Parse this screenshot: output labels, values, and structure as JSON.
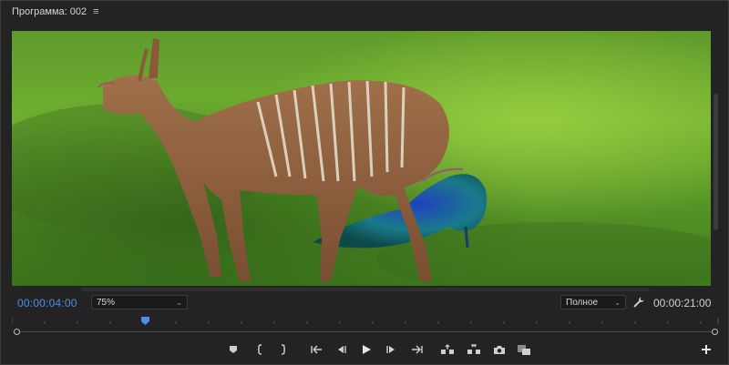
{
  "panel": {
    "title": "Программа: 002",
    "menu_icon": "hamburger-menu-icon"
  },
  "viewer": {
    "content": "video-frame"
  },
  "controls": {
    "current_timecode": "00:00:04:00",
    "zoom_value": "75%",
    "quality_value": "Полное",
    "duration_timecode": "00:00:21:00",
    "accent_color": "#4d8fe8"
  },
  "transport": {
    "buttons": [
      "add-marker-icon",
      "mark-in-icon",
      "mark-out-icon",
      "go-to-in-icon",
      "step-back-icon",
      "play-icon",
      "step-forward-icon",
      "go-to-out-icon",
      "lift-icon",
      "extract-icon",
      "export-frame-icon",
      "comparison-view-icon"
    ],
    "add_button": "plus-icon"
  }
}
